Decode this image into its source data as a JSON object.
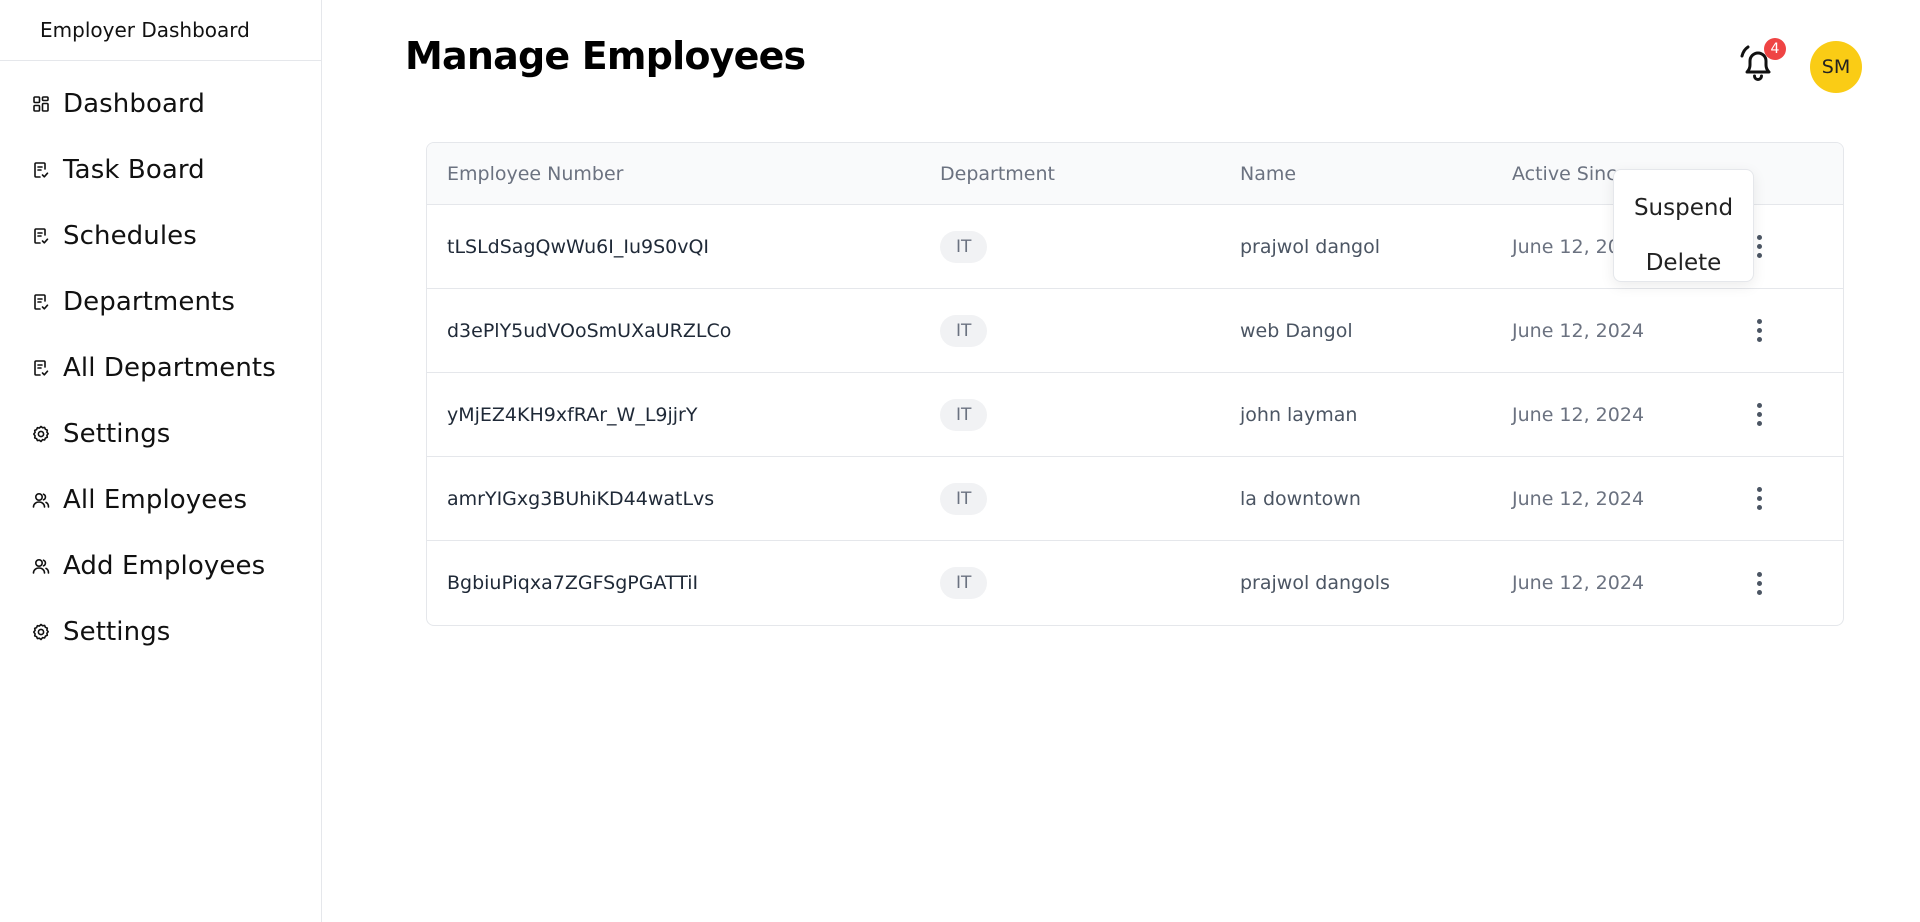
{
  "sidebar": {
    "title": "Employer Dashboard",
    "items": [
      {
        "label": "Dashboard",
        "icon": "grid-icon"
      },
      {
        "label": "Task Board",
        "icon": "clipboard-check-icon"
      },
      {
        "label": "Schedules",
        "icon": "clipboard-check-icon"
      },
      {
        "label": "Departments",
        "icon": "clipboard-check-icon"
      },
      {
        "label": "All Departments",
        "icon": "clipboard-check-icon"
      },
      {
        "label": "Settings",
        "icon": "gear-icon"
      },
      {
        "label": "All Employees",
        "icon": "users-icon"
      },
      {
        "label": "Add Employees",
        "icon": "users-icon"
      },
      {
        "label": "Settings",
        "icon": "gear-icon"
      }
    ]
  },
  "header": {
    "title": "Manage Employees",
    "notification_count": "4",
    "avatar_initials": "SM",
    "avatar_color": "#facc15",
    "badge_color": "#ef4444"
  },
  "table": {
    "columns": [
      "Employee Number",
      "Department",
      "Name",
      "Active Since"
    ],
    "rows": [
      {
        "employee_number": "tLSLdSagQwWu6I_Iu9S0vQI",
        "department": "IT",
        "name": "prajwol dangol",
        "active_since": "June 12, 2024"
      },
      {
        "employee_number": "d3ePlY5udVOoSmUXaURZLCo",
        "department": "IT",
        "name": "web Dangol",
        "active_since": "June 12, 2024"
      },
      {
        "employee_number": "yMjEZ4KH9xfRAr_W_L9jjrY",
        "department": "IT",
        "name": "john layman",
        "active_since": "June 12, 2024"
      },
      {
        "employee_number": "amrYIGxg3BUhiKD44watLvs",
        "department": "IT",
        "name": "la downtown",
        "active_since": "June 12, 2024"
      },
      {
        "employee_number": "BgbiuPiqxa7ZGFSgPGATTiI",
        "department": "IT",
        "name": "prajwol dangols",
        "active_since": "June 12, 2024"
      }
    ]
  },
  "row_menu": {
    "items": [
      "Suspend",
      "Delete"
    ]
  }
}
